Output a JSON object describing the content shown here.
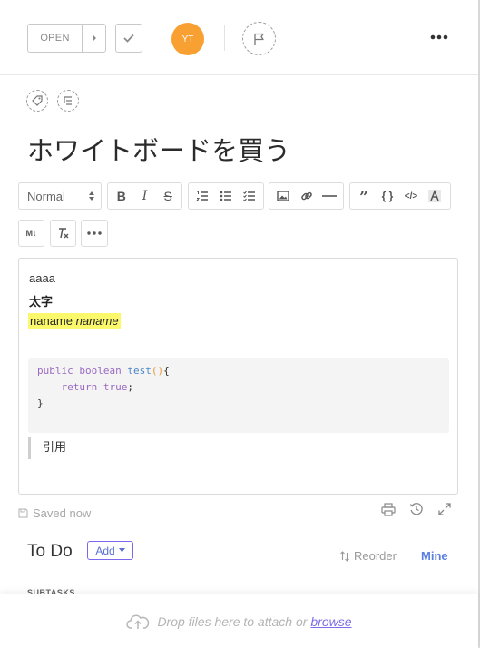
{
  "header": {
    "status_label": "OPEN",
    "assignee_initials": "YT",
    "colors": {
      "avatar": "#f9a032",
      "accent": "#7b68ee"
    }
  },
  "task": {
    "title": "ホワイトボードを買う"
  },
  "toolbar": {
    "text_style": "Normal",
    "icons": [
      "bold-icon",
      "italic-icon",
      "strikethrough-icon",
      "numbered-list-icon",
      "bullet-list-icon",
      "checklist-icon",
      "image-icon",
      "link-icon",
      "divider-icon",
      "quote-icon",
      "code-braces-icon",
      "code-inline-icon",
      "highlight-icon",
      "markdown-icon",
      "clear-format-icon",
      "more-icon"
    ]
  },
  "editor": {
    "line1": "aaaa",
    "line2": "太字",
    "line3_plain": "naname",
    "line3_italic": "naname",
    "code": {
      "kw1": "public",
      "kw2": "boolean",
      "fn": "test",
      "parens": "()",
      "brace_open": "{",
      "kw_return": "return",
      "kw_true": "true",
      "semicolon": ";",
      "brace_close": "}"
    },
    "quote": "引用"
  },
  "footer": {
    "saved_text": "Saved now"
  },
  "todo": {
    "title": "To Do",
    "add_label": "Add",
    "reorder_label": "Reorder",
    "mine_label": "Mine",
    "subtasks_label": "SUBTASKS"
  },
  "dropzone": {
    "text": "Drop files here to attach or",
    "browse_label": "browse"
  }
}
